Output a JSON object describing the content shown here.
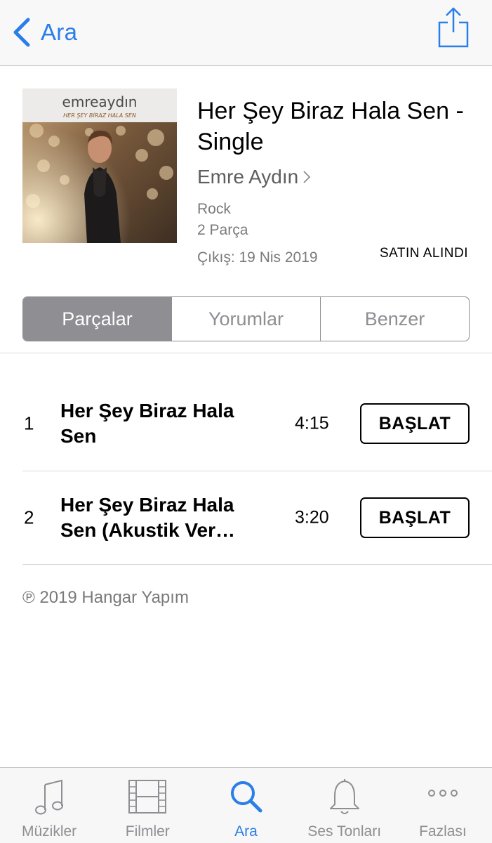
{
  "nav": {
    "back_label": "Ara"
  },
  "album": {
    "art_artist_logo": "emreaydın",
    "art_subtitle": "HER ŞEY BİRAZ HALA SEN",
    "title": "Her Şey Biraz Hala Sen - Single",
    "artist": "Emre Aydın",
    "genre": "Rock",
    "track_count": "2 Parça",
    "release": "Çıkış: 19 Nis 2019",
    "status": "SATIN ALINDI"
  },
  "segments": [
    {
      "label": "Parçalar",
      "active": true
    },
    {
      "label": "Yorumlar",
      "active": false
    },
    {
      "label": "Benzer",
      "active": false
    }
  ],
  "tracks": [
    {
      "number": "1",
      "title": "Her Şey Biraz Hala Sen",
      "duration": "4:15",
      "action": "BAŞLAT"
    },
    {
      "number": "2",
      "title": "Her Şey Biraz Hala Sen (Akustik Ver…",
      "duration": "3:20",
      "action": "BAŞLAT"
    }
  ],
  "copyright": "℗ 2019 Hangar Yapım",
  "tabbar": [
    {
      "label": "Müzikler",
      "icon": "music-note-icon",
      "active": false
    },
    {
      "label": "Filmler",
      "icon": "film-icon",
      "active": false
    },
    {
      "label": "Ara",
      "icon": "search-icon",
      "active": true
    },
    {
      "label": "Ses Tonları",
      "icon": "bell-icon",
      "active": false
    },
    {
      "label": "Fazlası",
      "icon": "more-icon",
      "active": false
    }
  ],
  "colors": {
    "accent": "#2a7ee8",
    "segment_active_bg": "#8e8e93",
    "secondary_text": "#7a7a7a"
  }
}
